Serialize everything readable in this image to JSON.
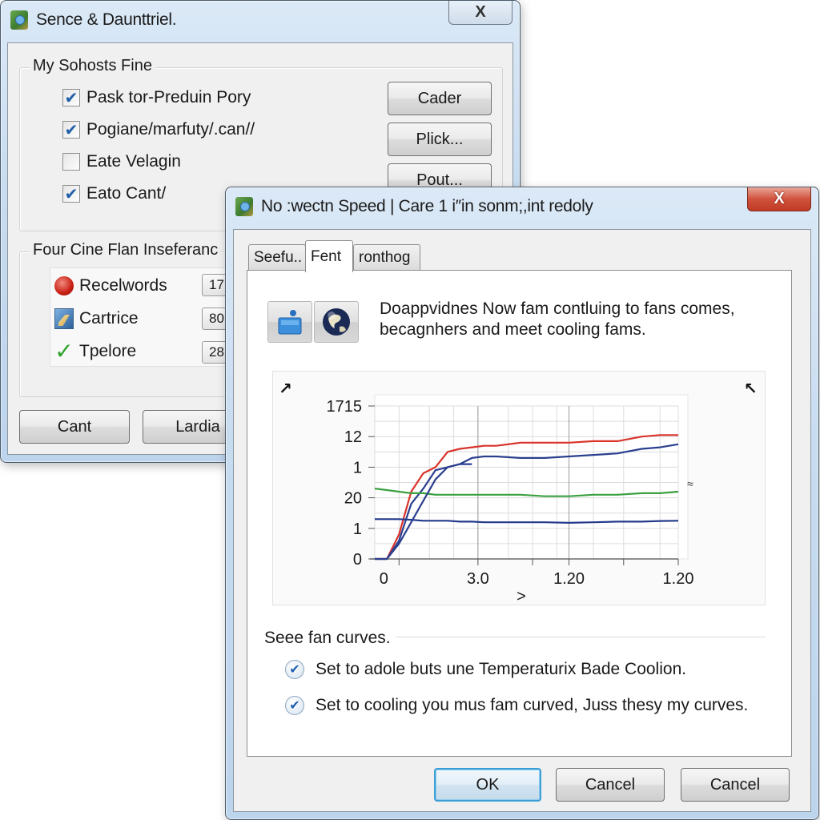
{
  "back_window": {
    "title": "Sence & Daunttriel.",
    "close_label": "X",
    "group1": {
      "legend": "My Sohosts Fine",
      "checkboxes": [
        {
          "label": "Pask tor-Preduin Pory",
          "checked": true
        },
        {
          "label": "Pogiane/marfuty/.can//",
          "checked": true
        },
        {
          "label": "Eate Velagin",
          "checked": false
        },
        {
          "label": "Eato Cant/",
          "checked": true
        }
      ],
      "buttons": [
        "Cader",
        "Plick...",
        "Pout..."
      ]
    },
    "group2": {
      "legend": "Four Cine Flan Inseferanc",
      "items": [
        {
          "icon": "red-record-icon",
          "label": "Recelwords",
          "value": "17"
        },
        {
          "icon": "blue-pencil-icon",
          "label": "Cartrice",
          "value": "80"
        },
        {
          "icon": "green-check-icon",
          "label": "Tpelore",
          "value": "28"
        }
      ]
    },
    "footer_buttons": [
      "Cant",
      "Lardia"
    ]
  },
  "front_window": {
    "title": "No :wectn Speed | Care 1 i″in sonm;,int redoly",
    "close_label": "X",
    "tabs": [
      {
        "label": "Seefu..",
        "active": false
      },
      {
        "label": "Fent",
        "active": true
      },
      {
        "label": "ronthog",
        "active": false
      }
    ],
    "icons": [
      "fan-device-icon",
      "globe-icon"
    ],
    "description": [
      "Doappvidnes Now fam contluing to fans comes,",
      "becagnhers and meet cooling fams."
    ],
    "corner_marks": {
      "left": "↗",
      "right": "↖",
      "side": "≈"
    },
    "section_label": "Seee fan curves.",
    "options": [
      {
        "label": "Set to adole buts une Temperaturix Bade Coolion.",
        "checked": true
      },
      {
        "label": "Set to cooling you mus fam curved, Juss thesy my curves.",
        "checked": true
      }
    ],
    "buttons": {
      "ok": "OK",
      "cancel1": "Cancel",
      "cancel2": "Cancel"
    }
  },
  "colors": {
    "series_red": "#d9342b",
    "series_blue": "#2b3f8f",
    "series_green": "#3aa040",
    "series_navy": "#233a8c"
  },
  "chart_data": {
    "type": "line",
    "title": "",
    "xlabel": ">",
    "ylabel": "",
    "y_tick_labels": [
      "0",
      "1",
      "20",
      "1",
      "12",
      "1715"
    ],
    "x_tick_labels": [
      "0",
      "3.0",
      "1.20",
      "1.20"
    ],
    "xlim": [
      0,
      100
    ],
    "ylim": [
      0,
      5
    ],
    "grid": true,
    "legend": "none",
    "x": [
      0,
      4,
      8,
      12,
      16,
      20,
      24,
      28,
      32,
      36,
      40,
      48,
      56,
      64,
      72,
      80,
      88,
      94,
      100
    ],
    "series": [
      {
        "name": "red",
        "color": "#d9342b",
        "values": [
          0,
          0,
          0.8,
          2.2,
          2.8,
          3.0,
          3.5,
          3.6,
          3.65,
          3.7,
          3.7,
          3.8,
          3.8,
          3.8,
          3.85,
          3.85,
          4.0,
          4.05,
          4.05
        ]
      },
      {
        "name": "blue",
        "color": "#2b3f8f",
        "values": [
          0,
          0,
          0.6,
          1.8,
          2.3,
          2.9,
          3.0,
          3.1,
          3.3,
          3.35,
          3.35,
          3.3,
          3.3,
          3.35,
          3.4,
          3.45,
          3.6,
          3.65,
          3.75
        ]
      },
      {
        "name": "green",
        "color": "#3aa040",
        "values": [
          2.3,
          2.25,
          2.2,
          2.15,
          2.15,
          2.1,
          2.1,
          2.1,
          2.1,
          2.1,
          2.1,
          2.1,
          2.05,
          2.05,
          2.1,
          2.1,
          2.15,
          2.15,
          2.2
        ]
      },
      {
        "name": "navy",
        "color": "#233a8c",
        "values": [
          1.3,
          1.3,
          1.3,
          1.28,
          1.25,
          1.25,
          1.25,
          1.22,
          1.22,
          1.2,
          1.2,
          1.2,
          1.2,
          1.18,
          1.2,
          1.22,
          1.22,
          1.24,
          1.25
        ]
      },
      {
        "name": "blue-rise",
        "color": "#2b3f8f",
        "values": [
          0,
          0,
          0.5,
          1.2,
          1.9,
          2.6,
          3.0,
          3.1,
          3.1,
          null,
          null,
          null,
          null,
          null,
          null,
          null,
          null,
          null,
          null
        ]
      }
    ]
  }
}
